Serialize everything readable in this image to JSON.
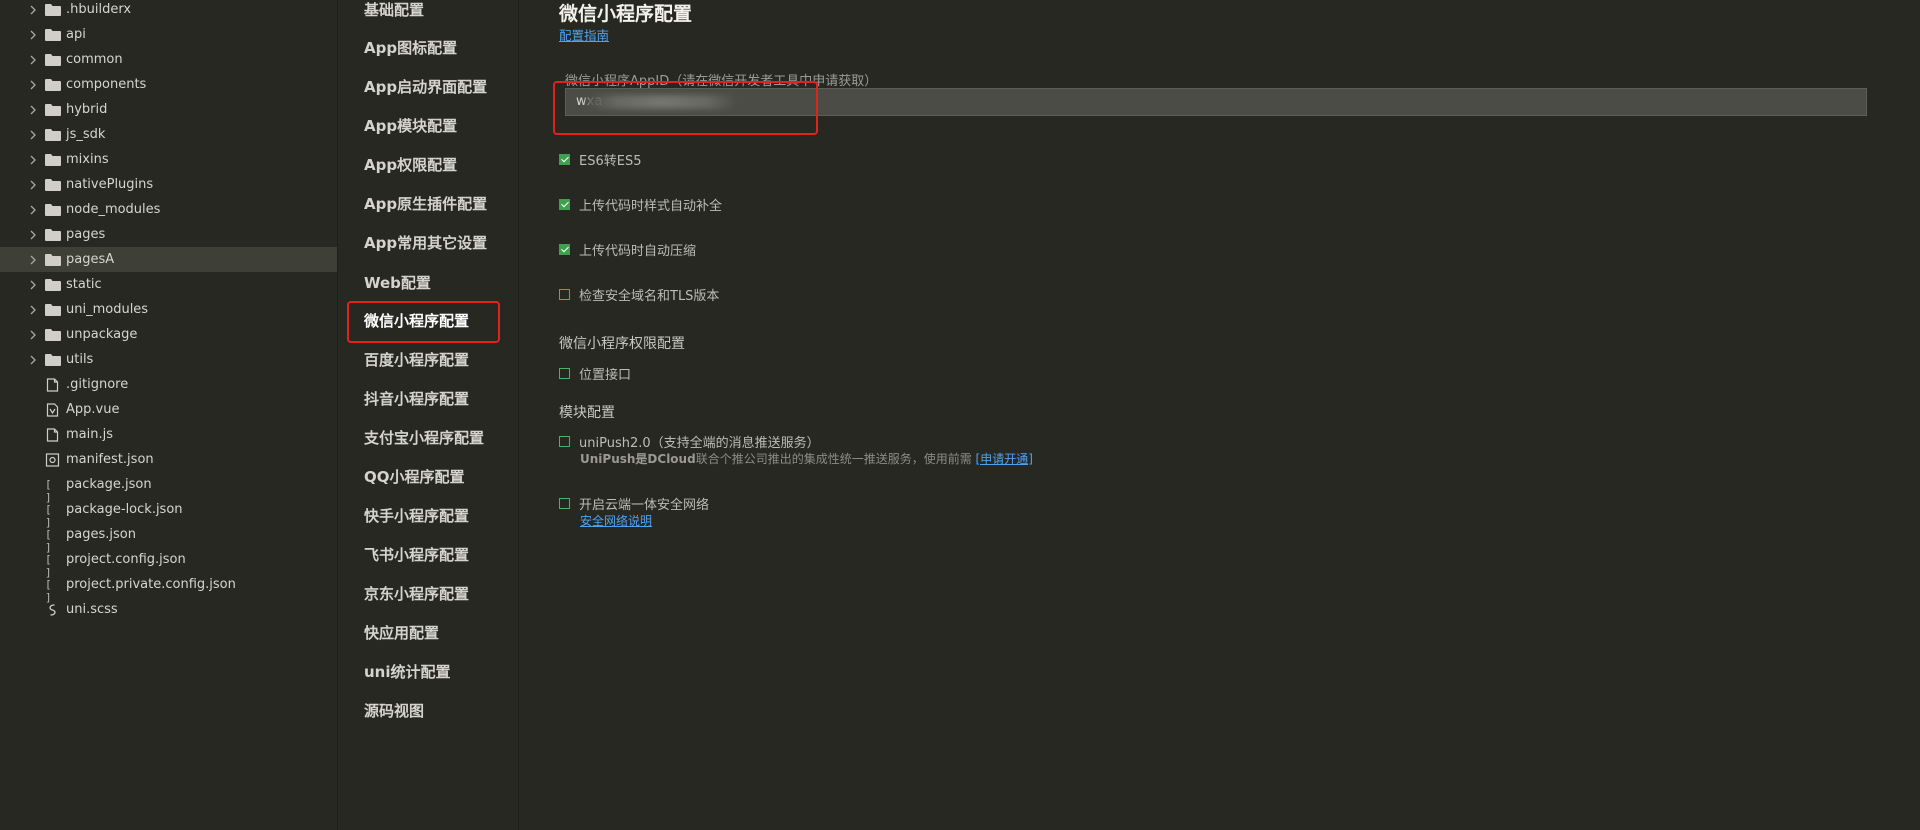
{
  "file_tree": {
    "folders": [
      ".hbuilderx",
      "api",
      "common",
      "components",
      "hybrid",
      "js_sdk",
      "mixins",
      "nativePlugins",
      "node_modules",
      "pages",
      "pagesA",
      "static",
      "uni_modules",
      "unpackage",
      "utils"
    ],
    "selected_folder": "pagesA",
    "files": [
      {
        "name": ".gitignore",
        "icon": "file-icon"
      },
      {
        "name": "App.vue",
        "icon": "vue-file-icon"
      },
      {
        "name": "main.js",
        "icon": "file-icon"
      },
      {
        "name": "manifest.json",
        "icon": "manifest-icon"
      },
      {
        "name": "package.json",
        "icon": "json-brackets-icon"
      },
      {
        "name": "package-lock.json",
        "icon": "json-brackets-icon"
      },
      {
        "name": "pages.json",
        "icon": "json-brackets-icon"
      },
      {
        "name": "project.config.json",
        "icon": "json-brackets-icon"
      },
      {
        "name": "project.private.config.json",
        "icon": "json-brackets-icon"
      },
      {
        "name": "uni.scss",
        "icon": "scss-file-icon"
      }
    ]
  },
  "nav": {
    "items": [
      "基础配置",
      "App图标配置",
      "App启动界面配置",
      "App模块配置",
      "App权限配置",
      "App原生插件配置",
      "App常用其它设置",
      "Web配置",
      "微信小程序配置",
      "百度小程序配置",
      "抖音小程序配置",
      "支付宝小程序配置",
      "QQ小程序配置",
      "快手小程序配置",
      "飞书小程序配置",
      "京东小程序配置",
      "快应用配置",
      "uni统计配置",
      "源码视图"
    ],
    "active": "微信小程序配置"
  },
  "content": {
    "title": "微信小程序配置",
    "guide_link": "配置指南",
    "appid_label": "微信小程序AppID（请在微信开发者工具中申请获取）",
    "appid_value": "wxa",
    "checkboxes": [
      {
        "label": "ES6转ES5",
        "checked": true
      },
      {
        "label": "上传代码时样式自动补全",
        "checked": true
      },
      {
        "label": "上传代码时自动压缩",
        "checked": true
      },
      {
        "label": "检查安全域名和TLS版本",
        "checked": false
      }
    ],
    "permission_section": {
      "title": "微信小程序权限配置",
      "location_label": "位置接口",
      "location_checked": false
    },
    "module_section": {
      "title": "模块配置",
      "unipush_label": "uniPush2.0（支持全端的消息推送服务）",
      "unipush_checked": false,
      "unipush_note_bold": "UniPush是DCloud",
      "unipush_note": "联合个推公司推出的集成性统一推送服务，使用前需",
      "unipush_link": "[申请开通]",
      "cloud_label": "开启云端一体安全网络",
      "cloud_checked": false,
      "cloud_link": "安全网络说明"
    }
  },
  "colors": {
    "background": "#272822",
    "selected_row": "#3e3f37",
    "checkbox_green": "#3fa14d",
    "link_blue": "#4da3f0",
    "highlight_red": "#e0241d"
  }
}
